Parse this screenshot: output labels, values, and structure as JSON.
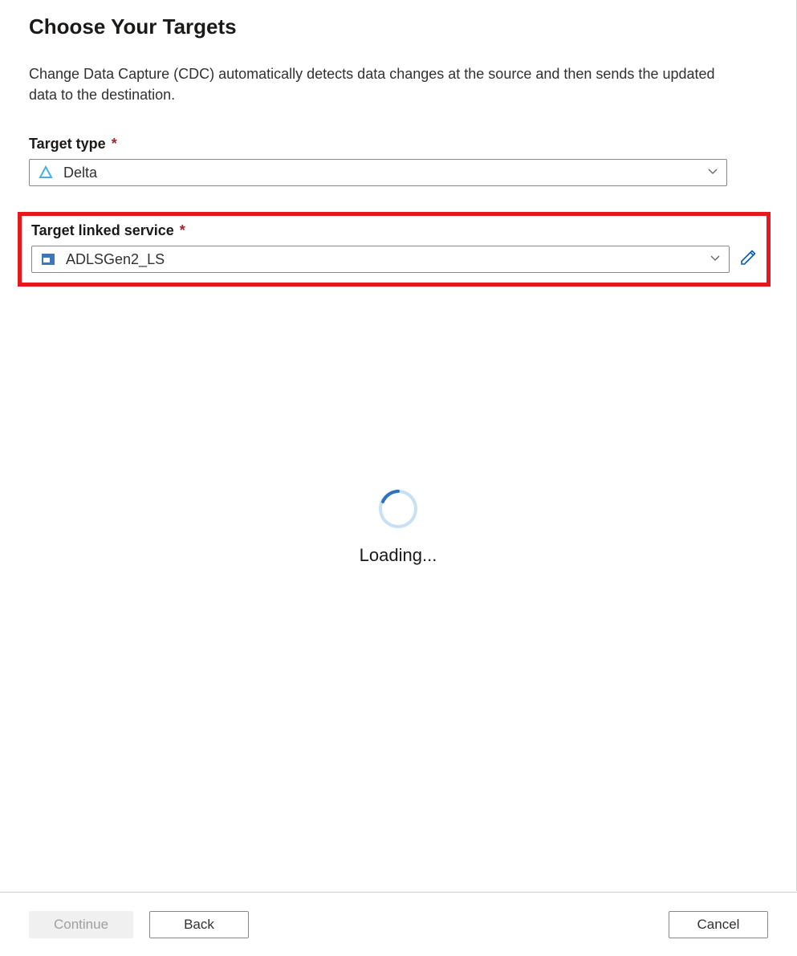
{
  "header": {
    "title": "Choose Your Targets",
    "description": "Change Data Capture (CDC) automatically detects data changes at the source and then sends the updated data to the destination."
  },
  "fields": {
    "targetType": {
      "label": "Target type",
      "value": "Delta",
      "required_marker": "*"
    },
    "linkedService": {
      "label": "Target linked service",
      "value": "ADLSGen2_LS",
      "required_marker": "*"
    }
  },
  "loading": {
    "text": "Loading..."
  },
  "footer": {
    "continue": "Continue",
    "back": "Back",
    "cancel": "Cancel"
  }
}
